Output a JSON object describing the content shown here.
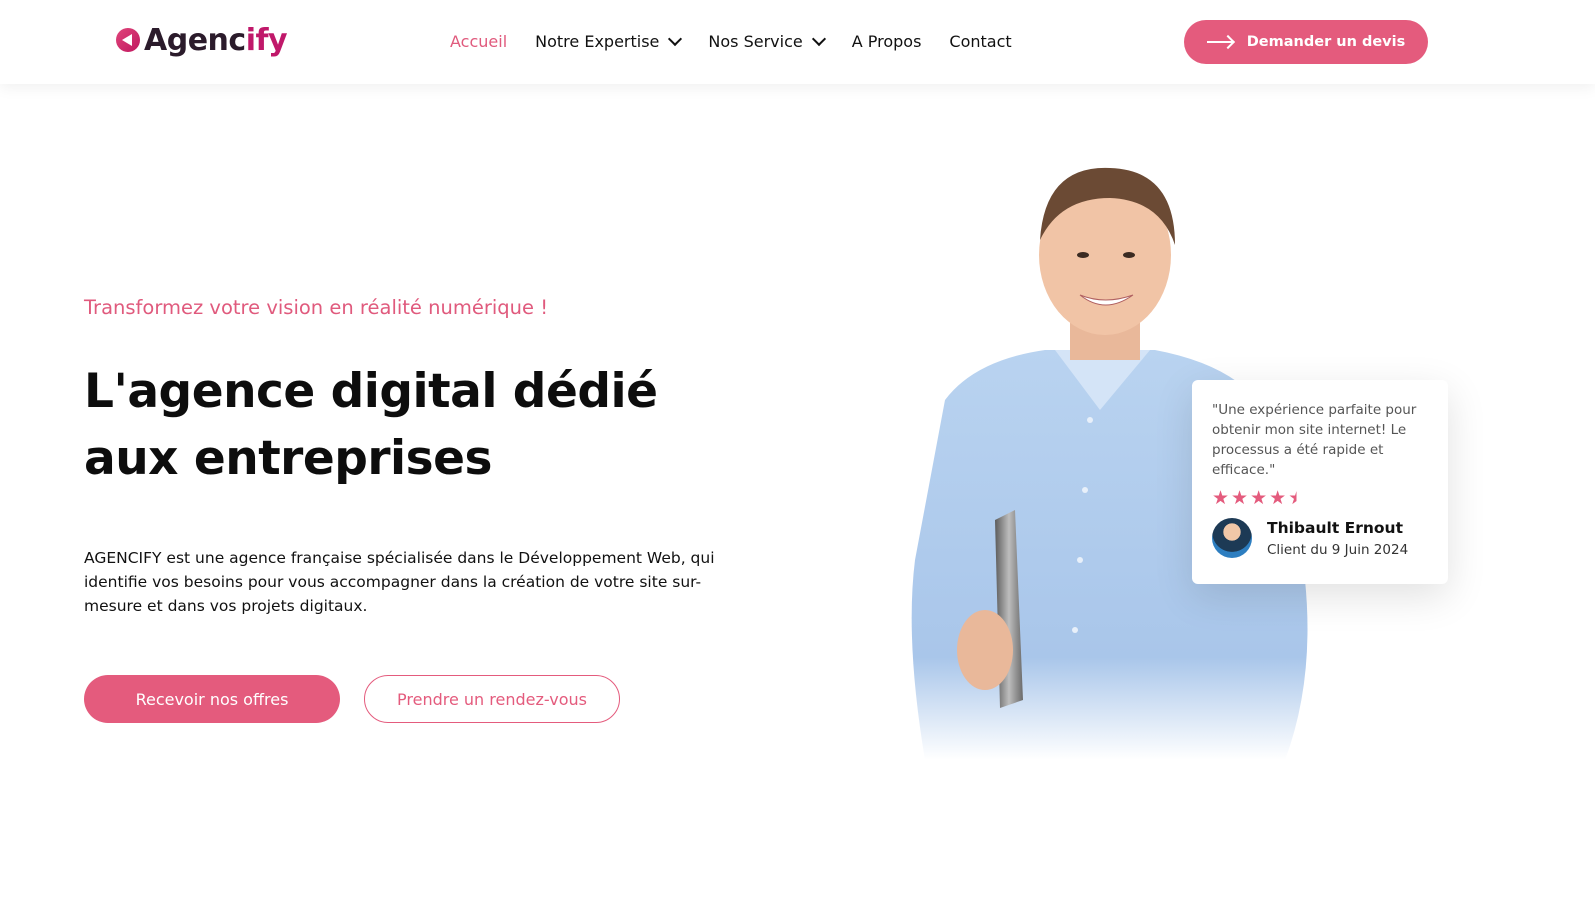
{
  "header": {
    "logo": {
      "text_main": "Agenc",
      "text_accent": "ify"
    },
    "nav": [
      {
        "label": "Accueil",
        "active": true,
        "dropdown": false
      },
      {
        "label": "Notre Expertise",
        "active": false,
        "dropdown": true
      },
      {
        "label": "Nos Service",
        "active": false,
        "dropdown": true
      },
      {
        "label": "A Propos",
        "active": false,
        "dropdown": false
      },
      {
        "label": "Contact",
        "active": false,
        "dropdown": false
      }
    ],
    "cta_label": "Demander un devis"
  },
  "hero": {
    "tagline": "Transformez votre vision en réalité numérique !",
    "title_line1": "L'agence digital dédié",
    "title_line2": "aux entreprises",
    "description": "AGENCIFY est une agence française spécialisée dans le Développement Web, qui identifie vos besoins pour vous accompagner dans la création de votre site sur-mesure et dans vos projets digitaux.",
    "primary_button": "Recevoir nos offres",
    "secondary_button": "Prendre un rendez-vous"
  },
  "review": {
    "quote": "\"Une expérience parfaite pour obtenir mon site internet! Le processus a été rapide et efficace.\"",
    "rating": 4.5,
    "rating_max": 5,
    "name": "Thibault Ernout",
    "date": "Client du 9 Juin 2024"
  },
  "colors": {
    "accent": "#e45b7d",
    "logo_accent": "#c0186a",
    "text": "#111111",
    "background": "#ffffff"
  }
}
